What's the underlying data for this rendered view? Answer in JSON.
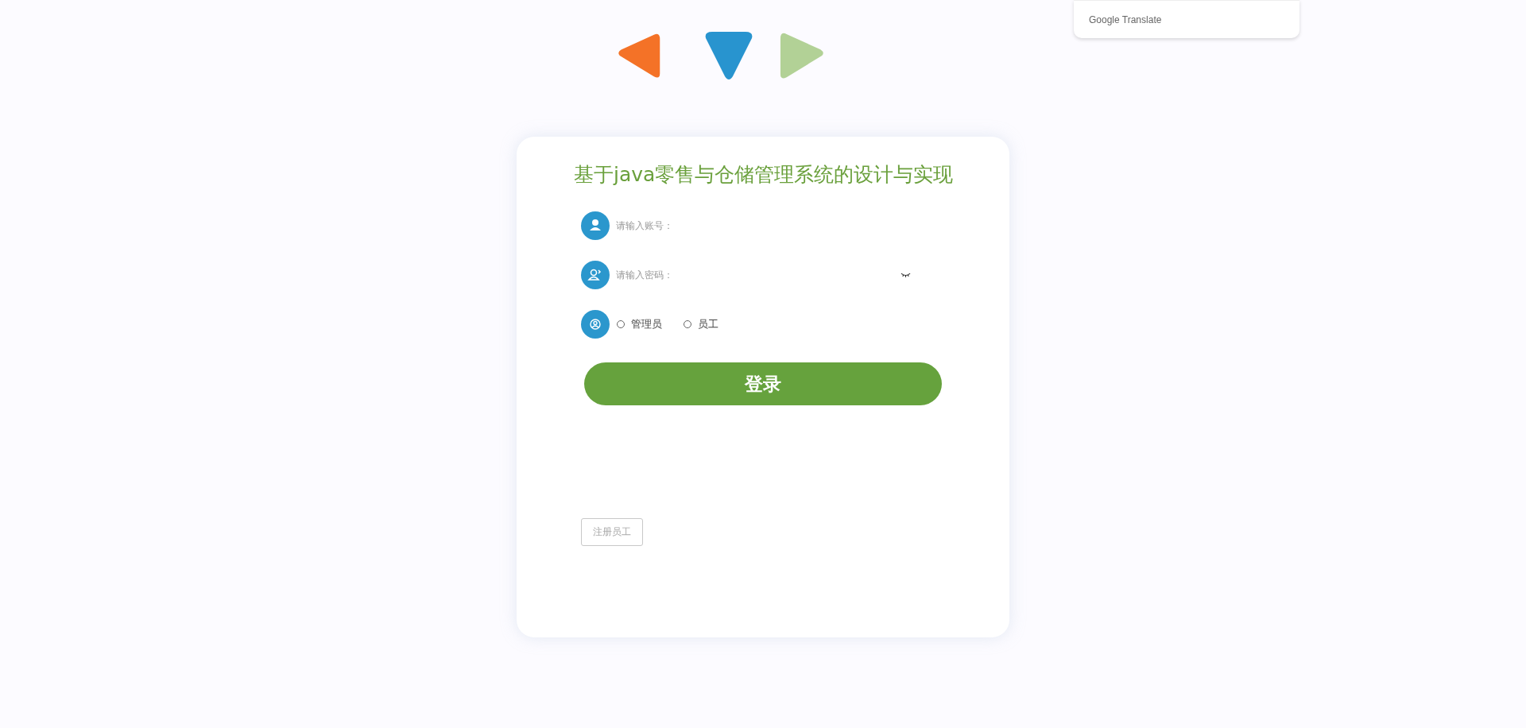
{
  "translate_popup": {
    "label": "Google Translate"
  },
  "logo_triangles": [
    {
      "kind": "left",
      "color": "#f47227"
    },
    {
      "kind": "down",
      "color": "#2894cf"
    },
    {
      "kind": "right",
      "color": "#b2d196"
    }
  ],
  "login_card": {
    "title": "基于java零售与仓储管理系统的设计与实现",
    "fields": [
      {
        "kind": "user",
        "placeholder": "请输入账号："
      },
      {
        "kind": "password",
        "placeholder": "请输入密码："
      }
    ],
    "roles": [
      {
        "label": "管理员",
        "selected": false
      },
      {
        "label": "员工",
        "selected": false
      }
    ],
    "login_button": "登录",
    "register_button": "注册员工"
  }
}
